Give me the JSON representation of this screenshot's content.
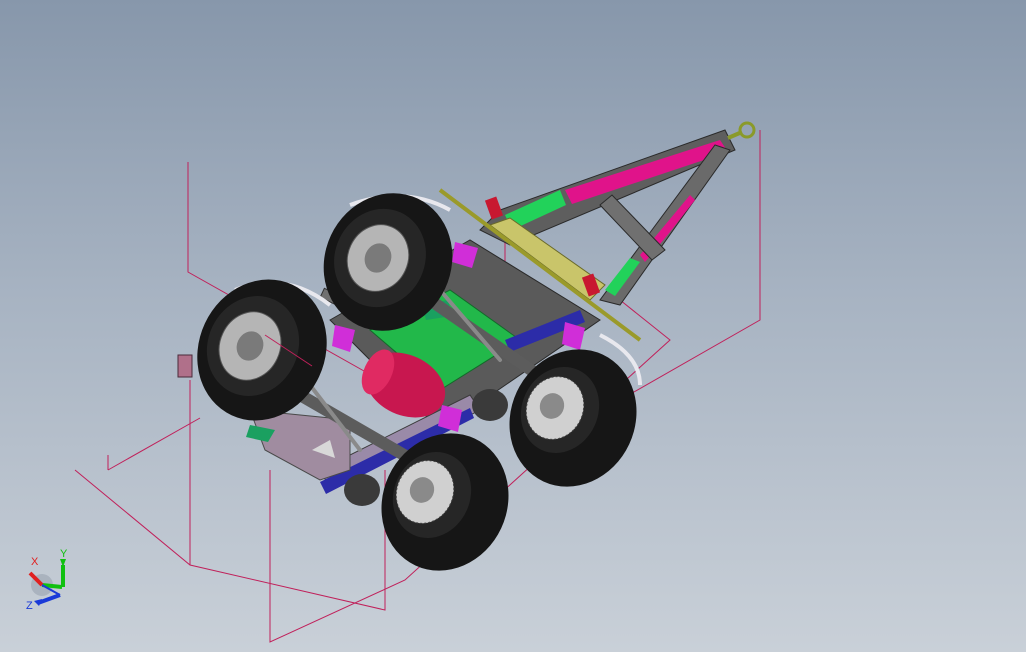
{
  "viewport": {
    "background_top": "#8797ab",
    "background_bottom": "#c9d0d8"
  },
  "model": {
    "description_icon": "trailer-chassis-assembly",
    "colors": {
      "frame_gray": "#6f6f6f",
      "tire": "#161616",
      "rim": "#a9a9a9",
      "accent_green": "#22d25a",
      "accent_magenta": "#e0138a",
      "accent_pink_purple": "#d02ed8",
      "accent_yellow": "#c9c56a",
      "accent_blue": "#2c2ca8",
      "tank_red": "#c8174f",
      "sketch_plane": "#c0205a"
    }
  },
  "triad": {
    "x_label": "X",
    "y_label": "Y",
    "z_label": "Z",
    "x_color": "#e02020",
    "y_color": "#10c010",
    "z_color": "#1a3ad8"
  }
}
